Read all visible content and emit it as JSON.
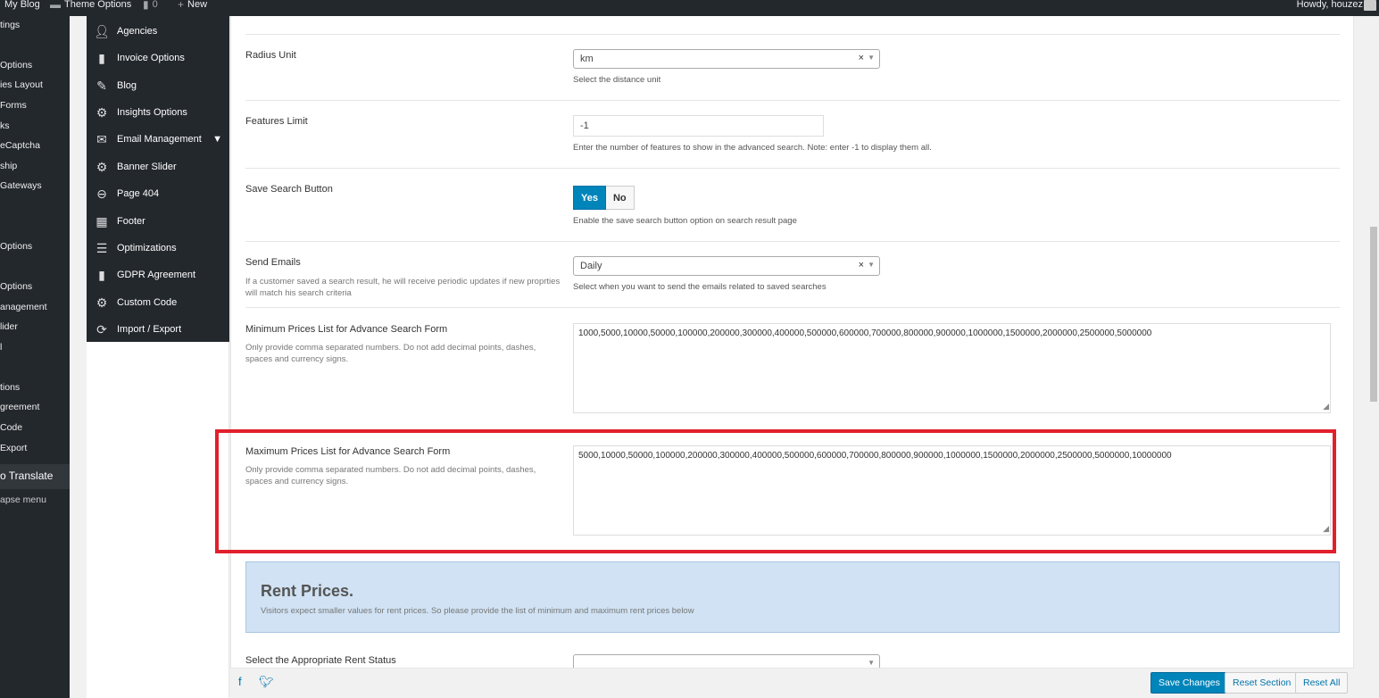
{
  "adminbar": {
    "site": "My Blog",
    "theme_options": "Theme Options",
    "comments": "0",
    "new": "New",
    "howdy": "Howdy, houzez"
  },
  "admin_menu": [
    "tings",
    "",
    "Options",
    "ies Layout",
    "Forms",
    "ks",
    "eCaptcha",
    "ship",
    "Gateways",
    "",
    "Options",
    "",
    "Options",
    "anagement",
    "lider",
    "l",
    "tions",
    "greement",
    "Code",
    "Export"
  ],
  "admin_menu_translate": "Translate",
  "admin_menu_collapse": "apse menu",
  "redux_nav": [
    {
      "label": "Agencies",
      "icon": "user-icon"
    },
    {
      "label": "Invoice Options",
      "icon": "document-icon"
    },
    {
      "label": "Blog",
      "icon": "edit-icon"
    },
    {
      "label": "Insights Options",
      "icon": "gear-icon"
    },
    {
      "label": "Email Management",
      "icon": "envelope-icon"
    },
    {
      "label": "Banner Slider",
      "icon": "gear-icon"
    },
    {
      "label": "Page 404",
      "icon": "minus-circle-icon"
    },
    {
      "label": "Footer",
      "icon": "table-icon"
    },
    {
      "label": "Optimizations",
      "icon": "list-icon"
    },
    {
      "label": "GDPR Agreement",
      "icon": "bookmark-icon"
    },
    {
      "label": "Custom Code",
      "icon": "gear-icon"
    },
    {
      "label": "Import / Export",
      "icon": "refresh-icon"
    }
  ],
  "fields": {
    "radius_unit": {
      "title": "Radius Unit",
      "value": "km",
      "desc": "Select the distance unit"
    },
    "features_limit": {
      "title": "Features Limit",
      "value": "-1",
      "desc": "Enter the number of features to show in the advanced search. Note: enter -1 to display them all."
    },
    "save_search": {
      "title": "Save Search Button",
      "yes": "Yes",
      "no": "No",
      "desc": "Enable the save search button option on search result page"
    },
    "send_emails": {
      "title": "Send Emails",
      "subtitle": "If a customer saved a search result, he will receive periodic updates if new proprties will match his search criteria",
      "value": "Daily",
      "desc": "Select when you want to send the emails related to saved searches"
    },
    "min_prices": {
      "title": "Minimum Prices List for Advance Search Form",
      "subtitle": "Only provide comma separated numbers. Do not add decimal points, dashes, spaces and currency signs.",
      "value": "1000,5000,10000,50000,100000,200000,300000,400000,500000,600000,700000,800000,900000,1000000,1500000,2000000,2500000,5000000"
    },
    "max_prices": {
      "title": "Maximum Prices List for Advance Search Form",
      "subtitle": "Only provide comma separated numbers. Do not add decimal points, dashes, spaces and currency signs.",
      "value": "5000,10000,50000,100000,200000,300000,400000,500000,600000,700000,800000,900000,1000000,1500000,2000000,2500000,5000000,10000000"
    },
    "rent_section": {
      "title": "Rent Prices.",
      "subtitle": "Visitors expect smaller values for rent prices. So please provide the list of minimum and maximum rent prices below"
    },
    "rent_status": {
      "title": "Select the Appropriate Rent Status"
    }
  },
  "footer": {
    "save": "Save Changes",
    "reset_section": "Reset Section",
    "reset_all": "Reset All"
  },
  "colors": {
    "primary": "#0085ba",
    "highlight": "#e1202c",
    "admin_dark": "#23282d"
  }
}
